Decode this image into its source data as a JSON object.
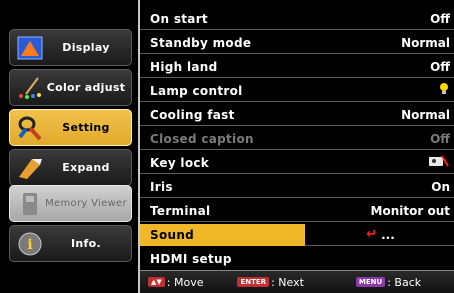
{
  "sidebar": {
    "items": [
      {
        "label": "Display",
        "icon": "display-icon"
      },
      {
        "label": "Color adjust",
        "icon": "color-adjust-icon"
      },
      {
        "label": "Setting",
        "icon": "setting-icon",
        "active": true
      },
      {
        "label": "Expand",
        "icon": "expand-icon"
      },
      {
        "label": "Memory Viewer",
        "icon": "memory-viewer-icon",
        "disabled": true
      },
      {
        "label": "Info.",
        "icon": "info-icon"
      }
    ]
  },
  "menu": {
    "rows": [
      {
        "label": "On start",
        "value": "Off"
      },
      {
        "label": "Standby mode",
        "value": "Normal"
      },
      {
        "label": "High land",
        "value": "Off"
      },
      {
        "label": "Lamp control",
        "value": "",
        "icon": "bulb-icon"
      },
      {
        "label": "Cooling fast",
        "value": "Normal"
      },
      {
        "label": "Closed caption",
        "value": "Off",
        "disabled": true
      },
      {
        "label": "Key lock",
        "value": "",
        "icon": "key-lock-icon"
      },
      {
        "label": "Iris",
        "value": "On"
      },
      {
        "label": "Terminal",
        "value": "Monitor out"
      },
      {
        "label": "Sound",
        "value": "...",
        "selected": true,
        "icon": "enter-arrow-icon"
      },
      {
        "label": "HDMI setup",
        "value": ""
      }
    ]
  },
  "footer": {
    "move_key": "▲▼",
    "move_label": ": Move",
    "enter_key": "ENTER",
    "enter_label": ": Next",
    "menu_key": "MENU",
    "menu_label": ": Back"
  },
  "colors": {
    "accent": "#f0b828",
    "background": "#000000"
  }
}
